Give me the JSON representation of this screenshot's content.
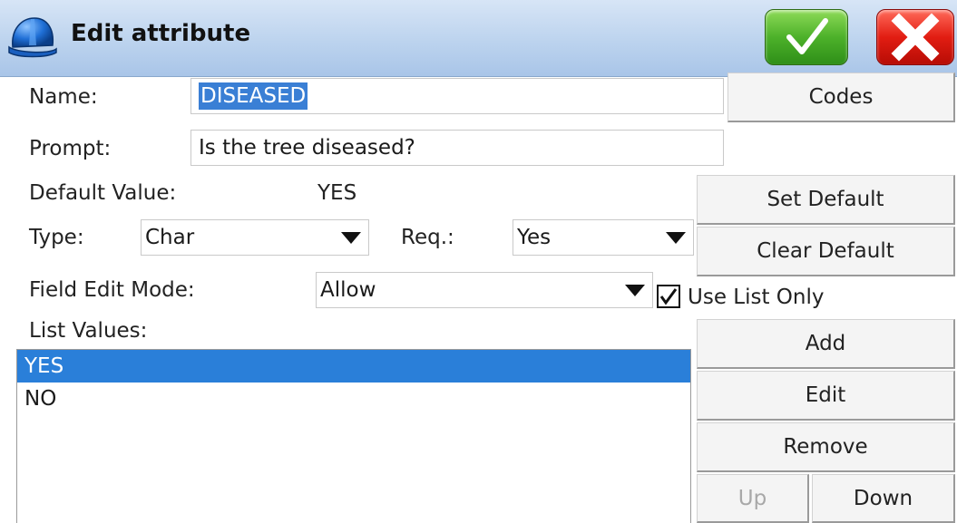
{
  "window": {
    "title": "Edit attribute"
  },
  "fields": {
    "name": {
      "label": "Name:",
      "value": "DISEASED"
    },
    "prompt": {
      "label": "Prompt:",
      "value": "Is the tree diseased?"
    },
    "default_value": {
      "label": "Default Value:",
      "value": "YES"
    },
    "type": {
      "label": "Type:",
      "value": "Char"
    },
    "required": {
      "label": "Req.:",
      "value": "Yes"
    },
    "field_edit_mode": {
      "label": "Field Edit Mode:",
      "value": "Allow"
    },
    "use_list_only": {
      "label": "Use List Only",
      "checked": true
    },
    "list_values": {
      "label": "List Values:",
      "items": [
        "YES",
        "NO"
      ],
      "selected_index": 0
    }
  },
  "buttons": {
    "codes": "Codes",
    "set_default": "Set Default",
    "clear_default": "Clear Default",
    "add": "Add",
    "edit": "Edit",
    "remove": "Remove",
    "up": "Up",
    "down": "Down"
  },
  "icons": {
    "app": "hard-hat-icon",
    "ok": "checkmark-icon",
    "cancel": "close-x-icon"
  },
  "colors": {
    "title_bar": "#bcd3ee",
    "ok_button": "#4db12a",
    "cancel_button": "#e21d12",
    "selection": "#2a7fd9"
  }
}
